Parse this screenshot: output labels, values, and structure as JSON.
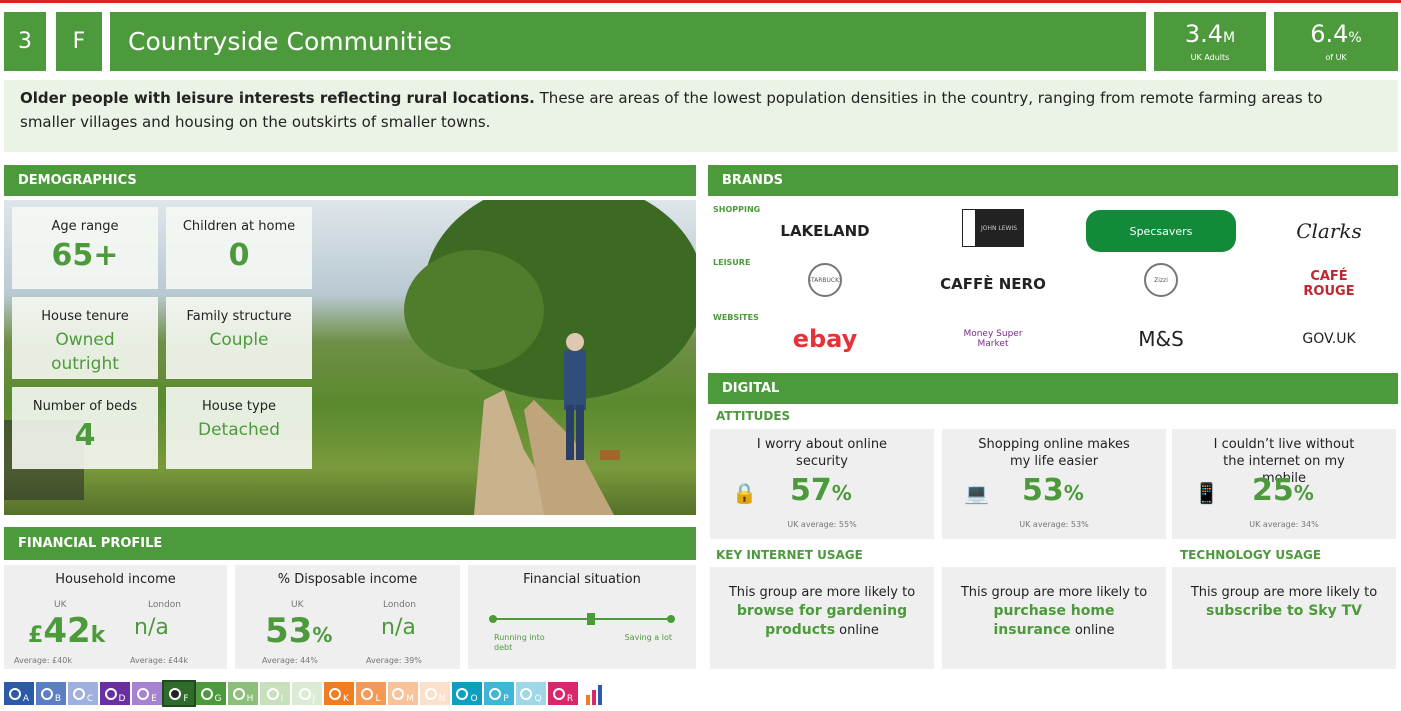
{
  "header": {
    "number": "3",
    "letter": "F",
    "title": "Countryside Communities",
    "adults_value": "3.4",
    "adults_unit": "M",
    "adults_label": "UK Adults",
    "share_value": "6.4",
    "share_unit": "%",
    "share_label": "of UK"
  },
  "intro": {
    "bold": "Older people with leisure interests reflecting rural locations.",
    "text": " These are areas of the lowest population densities in the country, ranging from remote farming areas to smaller villages and housing on the outskirts of  smaller towns."
  },
  "demographics": {
    "heading": "DEMOGRAPHICS",
    "cards": [
      {
        "label": "Age range",
        "value": "65+"
      },
      {
        "label": "Children at home",
        "value": "0"
      },
      {
        "label": "House tenure",
        "value": "Owned outright"
      },
      {
        "label": "Family structure",
        "value": "Couple"
      },
      {
        "label": "Number of beds",
        "value": "4"
      },
      {
        "label": "House type",
        "value": "Detached"
      }
    ]
  },
  "financial": {
    "heading": "FINANCIAL PROFILE",
    "income": {
      "title": "Household income",
      "uk_label": "UK",
      "london_label": "London",
      "uk_prefix": "£",
      "uk_value": "42",
      "uk_unit": "k",
      "london_value": "n/a",
      "uk_avg": "Average: £40k",
      "london_avg": "Average: £44k"
    },
    "disposable": {
      "title": "% Disposable income",
      "uk_label": "UK",
      "london_label": "London",
      "uk_value": "53",
      "uk_unit": "%",
      "london_value": "n/a",
      "uk_avg": "Average: 44%",
      "london_avg": "Average: 39%"
    },
    "situation": {
      "title": "Financial situation",
      "left_label": "Running into debt",
      "right_label": "Saving a lot",
      "position": 0.55
    }
  },
  "brands": {
    "heading": "BRANDS",
    "rows": [
      {
        "label": "SHOPPING",
        "items": [
          "LAKELAND",
          "JOHN LEWIS",
          "Specsavers",
          "Clarks"
        ]
      },
      {
        "label": "LEISURE",
        "items": [
          "STARBUCKS",
          "CAFFÈ NERO",
          "Zizzi",
          "CAFÉ ROUGE"
        ]
      },
      {
        "label": "WEBSITES",
        "items": [
          "ebay",
          "Money Super Market",
          "M&S",
          "GOV.UK"
        ]
      }
    ]
  },
  "digital": {
    "heading": "DIGITAL",
    "attitudes_heading": "ATTITUDES",
    "attitudes": [
      {
        "text": "I worry about online security",
        "value": "57",
        "unit": "%",
        "avg": "UK average: 55%",
        "icon": "lock-icon"
      },
      {
        "text": "Shopping online makes my life easier",
        "value": "53",
        "unit": "%",
        "avg": "UK average: 53%",
        "icon": "laptop-icon"
      },
      {
        "text": "I couldn’t live without the internet on my mobile",
        "value": "25",
        "unit": "%",
        "avg": "UK average: 34%",
        "icon": "mobile-icon"
      }
    ],
    "key_heading": "KEY INTERNET USAGE",
    "tech_heading": "TECHNOLOGY USAGE",
    "usage": [
      {
        "pre": "This group are more likely to ",
        "bold": "browse for gardening products",
        "post": " online"
      },
      {
        "pre": "This group are more likely to ",
        "bold": "purchase home insurance",
        "post": " online"
      },
      {
        "pre": "This group are more likely to ",
        "bold": "subscribe to Sky TV",
        "post": ""
      }
    ]
  },
  "groups": [
    "A",
    "B",
    "C",
    "D",
    "E",
    "F",
    "G",
    "H",
    "I",
    "J",
    "K",
    "L",
    "M",
    "N",
    "O",
    "P",
    "Q",
    "R"
  ],
  "group_colors": [
    "#2b5aa6",
    "#5b7fc4",
    "#9fb0e0",
    "#6a2fa0",
    "#a782d2",
    "#2f6b2a",
    "#4d9a3c",
    "#8cc07a",
    "#c8e0bd",
    "#dcebd5",
    "#f07d22",
    "#f59a55",
    "#f8c39b",
    "#fbe0cc",
    "#0e9fc0",
    "#3fb6d6",
    "#9fd6e8",
    "#d9276e"
  ]
}
